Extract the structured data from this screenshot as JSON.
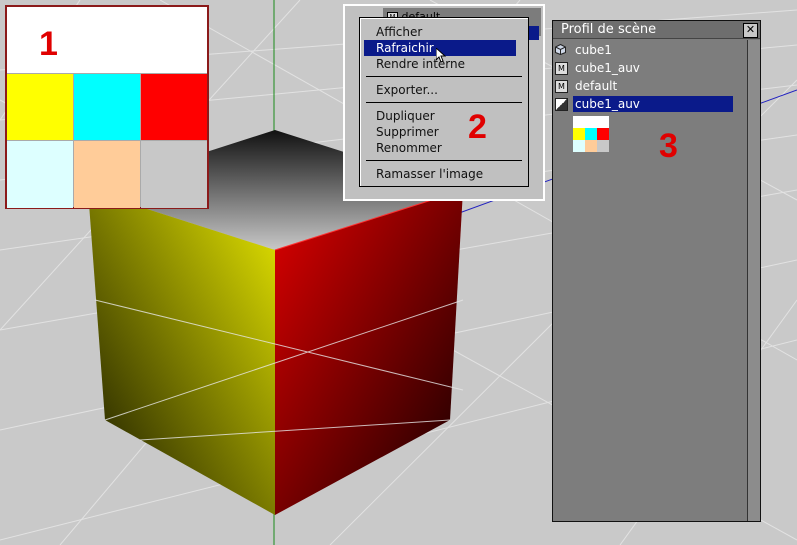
{
  "swatches": {
    "colors": [
      "#ffff00",
      "#00ffff",
      "#ff0000",
      "#ddffff",
      "#ffcc99",
      "#c8c8c8"
    ],
    "top_color": "#ffffff"
  },
  "callouts": [
    "1",
    "2",
    "3"
  ],
  "background_list": {
    "item": "default"
  },
  "context_menu": {
    "items": [
      {
        "label": "Afficher"
      },
      {
        "label": "Rafraichir"
      },
      {
        "label": "Rendre interne"
      },
      {
        "label": "Exporter..."
      },
      {
        "label": "Dupliquer"
      },
      {
        "label": "Supprimer"
      },
      {
        "label": "Renommer"
      },
      {
        "label": "Ramasser l'image"
      }
    ],
    "highlighted": "Rafraichir"
  },
  "scene_panel": {
    "title": "Profil de scène",
    "close_glyph": "✕",
    "items": [
      {
        "icon": "cube-icon",
        "label": "cube1"
      },
      {
        "icon": "material-icon",
        "icon_glyph": "M",
        "label": "cube1_auv"
      },
      {
        "icon": "material-icon",
        "icon_glyph": "M",
        "label": "default"
      },
      {
        "icon": "texture-icon",
        "label": "cube1_auv",
        "selected": true
      }
    ]
  },
  "colors": {
    "selection": "#0a1a8a",
    "callout_red": "#e00000",
    "cube_left": "#d8d800",
    "cube_right": "#c80000"
  }
}
